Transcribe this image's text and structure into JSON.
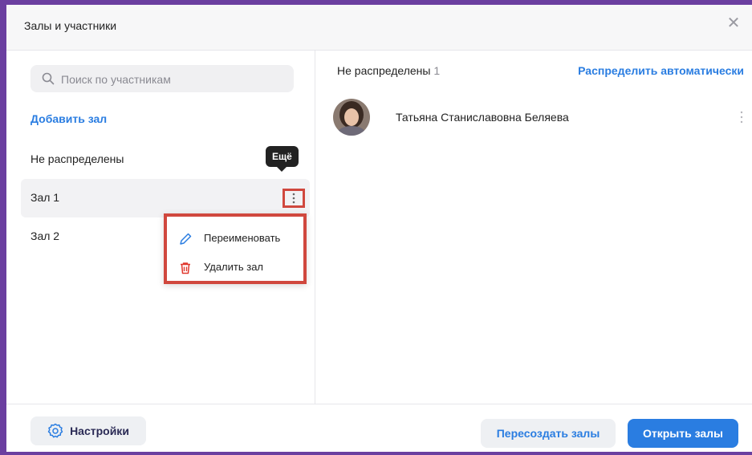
{
  "dialog": {
    "title": "Залы и участники"
  },
  "left": {
    "search_placeholder": "Поиск по участникам",
    "add_hall": "Добавить зал",
    "items": [
      {
        "label": "Не распределены"
      },
      {
        "label": "Зал 1"
      },
      {
        "label": "Зал 2"
      }
    ],
    "tooltip": "Ещё",
    "menu": {
      "rename": "Переименовать",
      "delete": "Удалить зал"
    }
  },
  "right": {
    "heading": "Не распределены",
    "count": "1",
    "auto_assign": "Распределить автоматически",
    "participants": [
      {
        "name": "Татьяна Станиславовна Беляева"
      }
    ]
  },
  "footer": {
    "settings": "Настройки",
    "recreate": "Пересоздать залы",
    "open": "Открыть залы"
  },
  "colors": {
    "accent": "#2a7de1",
    "highlight": "#d0483e",
    "frame": "#6b3fa0"
  }
}
